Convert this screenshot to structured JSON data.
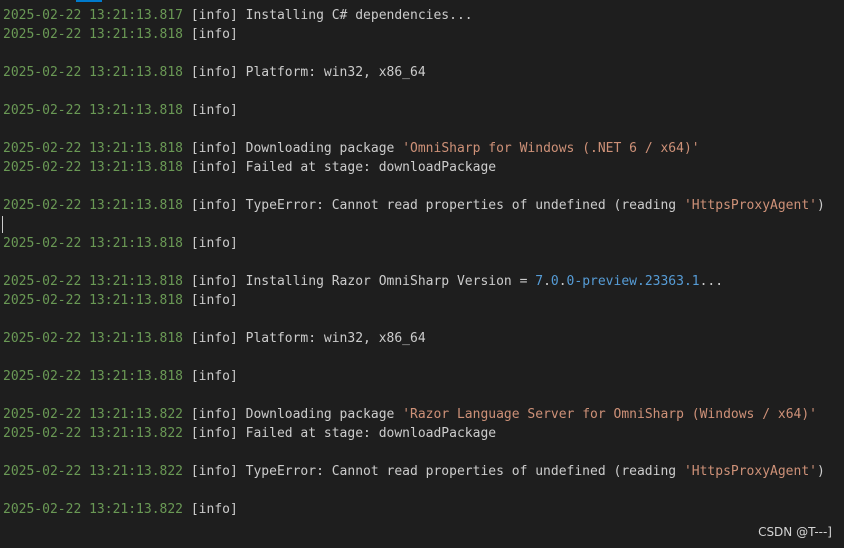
{
  "colors": {
    "background": "#1e1e1e",
    "timestamp": "#6a9955",
    "text": "#cccccc",
    "string": "#ce9178",
    "number": "#b5cea8",
    "keyword": "#569cd6"
  },
  "lines": [
    {
      "ts": "2025-02-22 13:21:13.817",
      "level": "[info]",
      "msg": "Installing C# dependencies..."
    },
    {
      "ts": "2025-02-22 13:21:13.818",
      "level": "[info]",
      "msg": ""
    },
    {
      "ts": "",
      "level": "",
      "msg": ""
    },
    {
      "ts": "2025-02-22 13:21:13.818",
      "level": "[info]",
      "msg": "Platform: win32, x86_64"
    },
    {
      "ts": "",
      "level": "",
      "msg": ""
    },
    {
      "ts": "2025-02-22 13:21:13.818",
      "level": "[info]",
      "msg": ""
    },
    {
      "ts": "",
      "level": "",
      "msg": ""
    },
    {
      "ts": "2025-02-22 13:21:13.818",
      "level": "[info]",
      "msg": "Downloading package ",
      "str": "'OmniSharp for Windows (.NET 6 / x64)'"
    },
    {
      "ts": "2025-02-22 13:21:13.818",
      "level": "[info]",
      "msg": "Failed at stage: downloadPackage"
    },
    {
      "ts": "",
      "level": "",
      "msg": ""
    },
    {
      "ts": "2025-02-22 13:21:13.818",
      "level": "[info]",
      "msg": "TypeError: Cannot read properties of undefined (reading ",
      "str": "'HttpsProxyAgent'",
      "tail": ")"
    },
    {
      "ts": "",
      "level": "",
      "msg": ""
    },
    {
      "ts": "2025-02-22 13:21:13.818",
      "level": "[info]",
      "msg": ""
    },
    {
      "ts": "",
      "level": "",
      "msg": ""
    },
    {
      "ts": "2025-02-22 13:21:13.818",
      "level": "[info]",
      "msg": "Installing Razor OmniSharp Version = ",
      "version": {
        "major": "7",
        "dot1": ".",
        "minor": "0",
        "dot2": ".",
        "patch": "0",
        "pre": "-preview.23363.1"
      },
      "tail": "..."
    },
    {
      "ts": "2025-02-22 13:21:13.818",
      "level": "[info]",
      "msg": ""
    },
    {
      "ts": "",
      "level": "",
      "msg": ""
    },
    {
      "ts": "2025-02-22 13:21:13.818",
      "level": "[info]",
      "msg": "Platform: win32, x86_64"
    },
    {
      "ts": "",
      "level": "",
      "msg": ""
    },
    {
      "ts": "2025-02-22 13:21:13.818",
      "level": "[info]",
      "msg": ""
    },
    {
      "ts": "",
      "level": "",
      "msg": ""
    },
    {
      "ts": "2025-02-22 13:21:13.822",
      "level": "[info]",
      "msg": "Downloading package ",
      "str": "'Razor Language Server for OmniSharp (Windows / x64)'"
    },
    {
      "ts": "2025-02-22 13:21:13.822",
      "level": "[info]",
      "msg": "Failed at stage: downloadPackage"
    },
    {
      "ts": "",
      "level": "",
      "msg": ""
    },
    {
      "ts": "2025-02-22 13:21:13.822",
      "level": "[info]",
      "msg": "TypeError: Cannot read properties of undefined (reading ",
      "str": "'HttpsProxyAgent'",
      "tail": ")"
    },
    {
      "ts": "",
      "level": "",
      "msg": ""
    },
    {
      "ts": "2025-02-22 13:21:13.822",
      "level": "[info]",
      "msg": ""
    }
  ],
  "watermark": "CSDN @T---]"
}
